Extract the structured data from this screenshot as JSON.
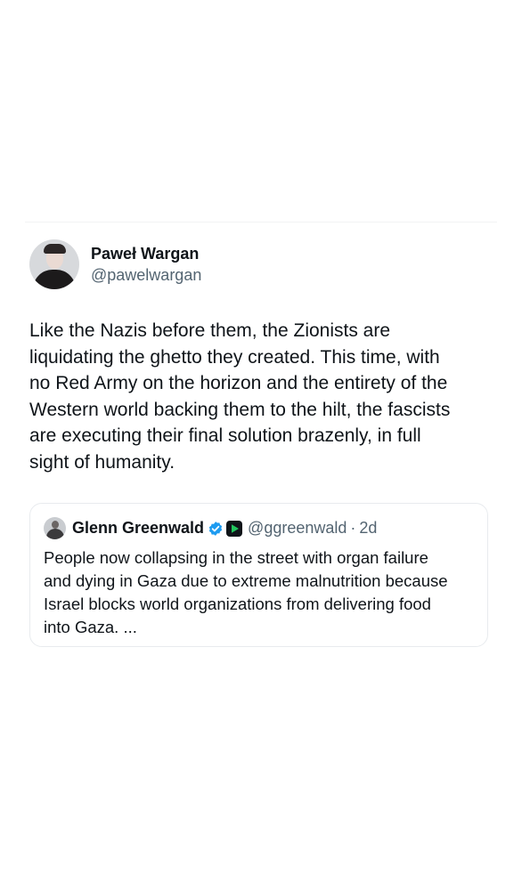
{
  "tweet": {
    "author": {
      "display_name": "Paweł Wargan",
      "handle": "@pawelwargan"
    },
    "text": "Like the Nazis before them, the Zionists are\nliquidating the ghetto they created. This time, with\nno Red Army on the horizon and the entirety of the\nWestern world backing them to the hilt, the fascists\nare executing their final solution brazenly, in full\nsight of humanity."
  },
  "quoted_tweet": {
    "author": {
      "display_name": "Glenn Greenwald",
      "handle": "@ggreenwald",
      "verified": true,
      "affiliation_badge": "play-icon"
    },
    "separator": "·",
    "time": "2d",
    "text": "People now collapsing in the street with organ failure\nand dying in Gaza due to extreme malnutrition because\nIsrael blocks world organizations from delivering food\ninto Gaza. ..."
  },
  "colors": {
    "text_primary": "#0f1419",
    "text_secondary": "#536471",
    "verified_blue": "#1d9bf0",
    "affiliation_green": "#22c55e",
    "card_border": "#e8ebee"
  }
}
